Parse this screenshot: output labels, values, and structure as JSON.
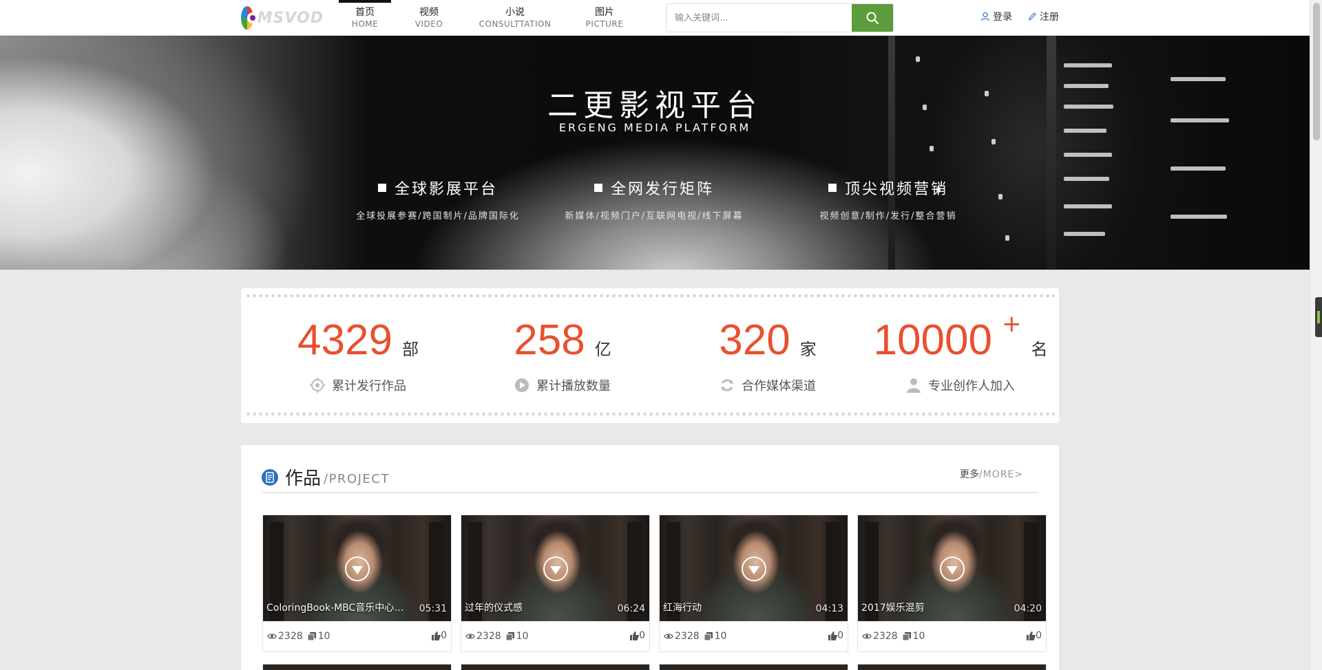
{
  "logo": {
    "text": "MSVOD"
  },
  "nav": [
    {
      "cn": "首页",
      "en": "HOME",
      "active": true
    },
    {
      "cn": "视频",
      "en": "VIDEO",
      "active": false
    },
    {
      "cn": "小说",
      "en": "CONSULTTATION",
      "active": false
    },
    {
      "cn": "图片",
      "en": "PICTURE",
      "active": false
    }
  ],
  "search": {
    "placeholder": "输入关键词..."
  },
  "user": {
    "login": "登录",
    "register": "注册"
  },
  "banner": {
    "title": "二更影视平台",
    "subtitle": "ERGENG MEDIA PLATFORM",
    "features": [
      {
        "title": "全球影展平台",
        "desc": "全球投展参赛/跨国制片/品牌国际化"
      },
      {
        "title": "全网发行矩阵",
        "desc": "新媒体/视频门户/互联网电视/线下屏幕"
      },
      {
        "title": "顶尖视频营销",
        "desc": "视频创意/制作/发行/整合营销"
      }
    ]
  },
  "stats": [
    {
      "num": "4329",
      "unit": "部",
      "label": "累计发行作品",
      "icon": "target-icon"
    },
    {
      "num": "258",
      "unit": "亿",
      "label": "累计播放数量",
      "icon": "play-circle-icon"
    },
    {
      "num": "320",
      "unit": "家",
      "label": "合作媒体渠道",
      "icon": "sync-icon"
    },
    {
      "num": "10000",
      "plus": "+",
      "unit": "名",
      "label": "专业创作人加入",
      "icon": "person-icon"
    }
  ],
  "project": {
    "title_cn": "作品",
    "title_en": "/PROJECT",
    "more_cn": "更多",
    "more_en": "/MORE>",
    "items": [
      {
        "title": "ColoringBook-MBC音乐中心直拍",
        "duration": "05:31",
        "views": "2328",
        "count": "10",
        "likes": "0"
      },
      {
        "title": "过年的仪式感",
        "duration": "06:24",
        "views": "2328",
        "count": "10",
        "likes": "0"
      },
      {
        "title": "红海行动",
        "duration": "04:13",
        "views": "2328",
        "count": "10",
        "likes": "0"
      },
      {
        "title": "2017娱乐混剪",
        "duration": "04:20",
        "views": "2328",
        "count": "10",
        "likes": "0"
      }
    ]
  },
  "colors": {
    "accent": "#e8502f",
    "search_button": "#5b9c3d",
    "header_bg": "#ffffff",
    "page_bg": "#e9e9e9"
  }
}
